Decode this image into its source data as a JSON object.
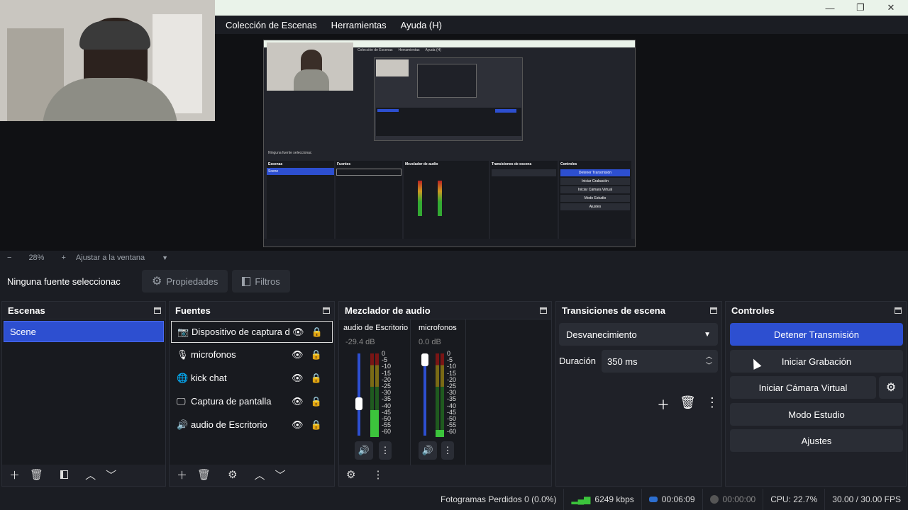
{
  "menu": {
    "scene_collection": "Colección de Escenas",
    "tools": "Herramientas",
    "help": "Ayuda (H)"
  },
  "zoom": {
    "minus": "−",
    "value": "28%",
    "plus": "+",
    "fit": "Ajustar a la ventana"
  },
  "source_bar": {
    "no_source": "Ninguna fuente seleccionac",
    "properties": "Propiedades",
    "filters": "Filtros"
  },
  "scenes": {
    "title": "Escenas",
    "items": [
      "Scene"
    ]
  },
  "sources": {
    "title": "Fuentes",
    "items": [
      "Dispositivo de captura de",
      "microfonos",
      "kick chat",
      "Captura de pantalla",
      "audio de Escritorio"
    ]
  },
  "mixer": {
    "title": "Mezclador de audio",
    "channels": [
      {
        "name": "audio de Escritorio",
        "db": "-29.4 dB",
        "level": 0.45
      },
      {
        "name": "microfonos",
        "db": "0.0 dB",
        "level": 1.0
      }
    ],
    "scale": [
      "0",
      "-5",
      "-10",
      "-15",
      "-20",
      "-25",
      "-30",
      "-35",
      "-40",
      "-45",
      "-50",
      "-55",
      "-60"
    ]
  },
  "transitions": {
    "title": "Transiciones de escena",
    "selected": "Desvanecimiento",
    "duration_label": "Duración",
    "duration_value": "350 ms"
  },
  "controls": {
    "title": "Controles",
    "stop_stream": "Detener Transmisión",
    "start_record": "Iniciar Grabación",
    "virtual_cam": "Iniciar Cámara Virtual",
    "studio_mode": "Modo Estudio",
    "settings": "Ajustes"
  },
  "status": {
    "dropped": "Fotogramas Perdidos 0 (0.0%)",
    "bitrate": "6249 kbps",
    "stream_time": "00:06:09",
    "rec_time": "00:00:00",
    "cpu": "CPU: 22.7%",
    "fps": "30.00 / 30.00 FPS"
  },
  "preview_inner": {
    "menu1": "Colección de Escenas",
    "menu2": "Herramientas",
    "menu3": "Ayuda (H)",
    "no_source": "Ninguna fuente seleccionac",
    "scenes": "Escenas",
    "scene": "Scene",
    "sources": "Fuentes",
    "mixer": "Mezclador de audio",
    "transitions": "Transiciones de escena",
    "controls": "Controles",
    "stop": "Detener Transmisión",
    "record": "Iniciar Grabación",
    "vcam": "Iniciar Cámara Virtual",
    "studio": "Modo Estudio",
    "settings": "Ajustes"
  },
  "colors": {
    "accent": "#2d4fd0",
    "bg": "#1b1d23",
    "panel": "#1f2128"
  }
}
